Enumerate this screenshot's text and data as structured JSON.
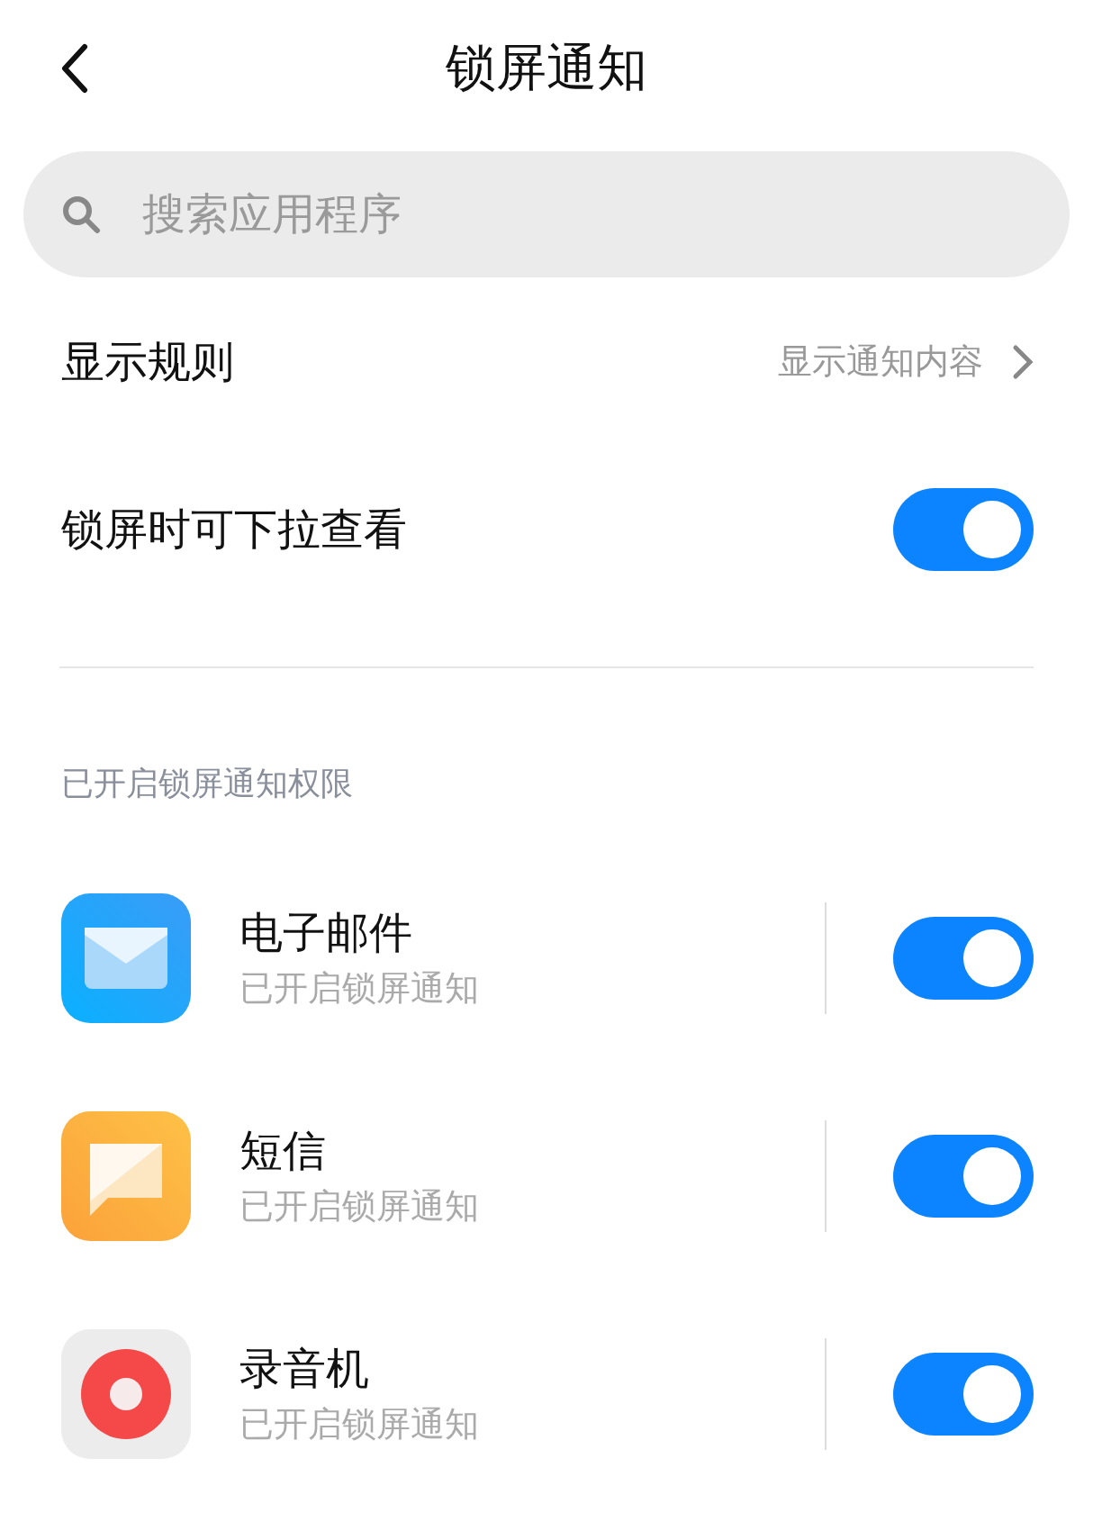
{
  "header": {
    "title": "锁屏通知"
  },
  "search": {
    "placeholder": "搜索应用程序"
  },
  "settings": [
    {
      "kind": "link",
      "label": "显示规则",
      "value": "显示通知内容"
    },
    {
      "kind": "toggle",
      "label": "锁屏时可下拉查看",
      "on": true
    }
  ],
  "section_title": "已开启锁屏通知权限",
  "apps": [
    {
      "kind": "mail",
      "name": "电子邮件",
      "status": "已开启锁屏通知",
      "on": true
    },
    {
      "kind": "message",
      "name": "短信",
      "status": "已开启锁屏通知",
      "on": true
    },
    {
      "kind": "recorder",
      "name": "录音机",
      "status": "已开启锁屏通知",
      "on": true
    }
  ]
}
